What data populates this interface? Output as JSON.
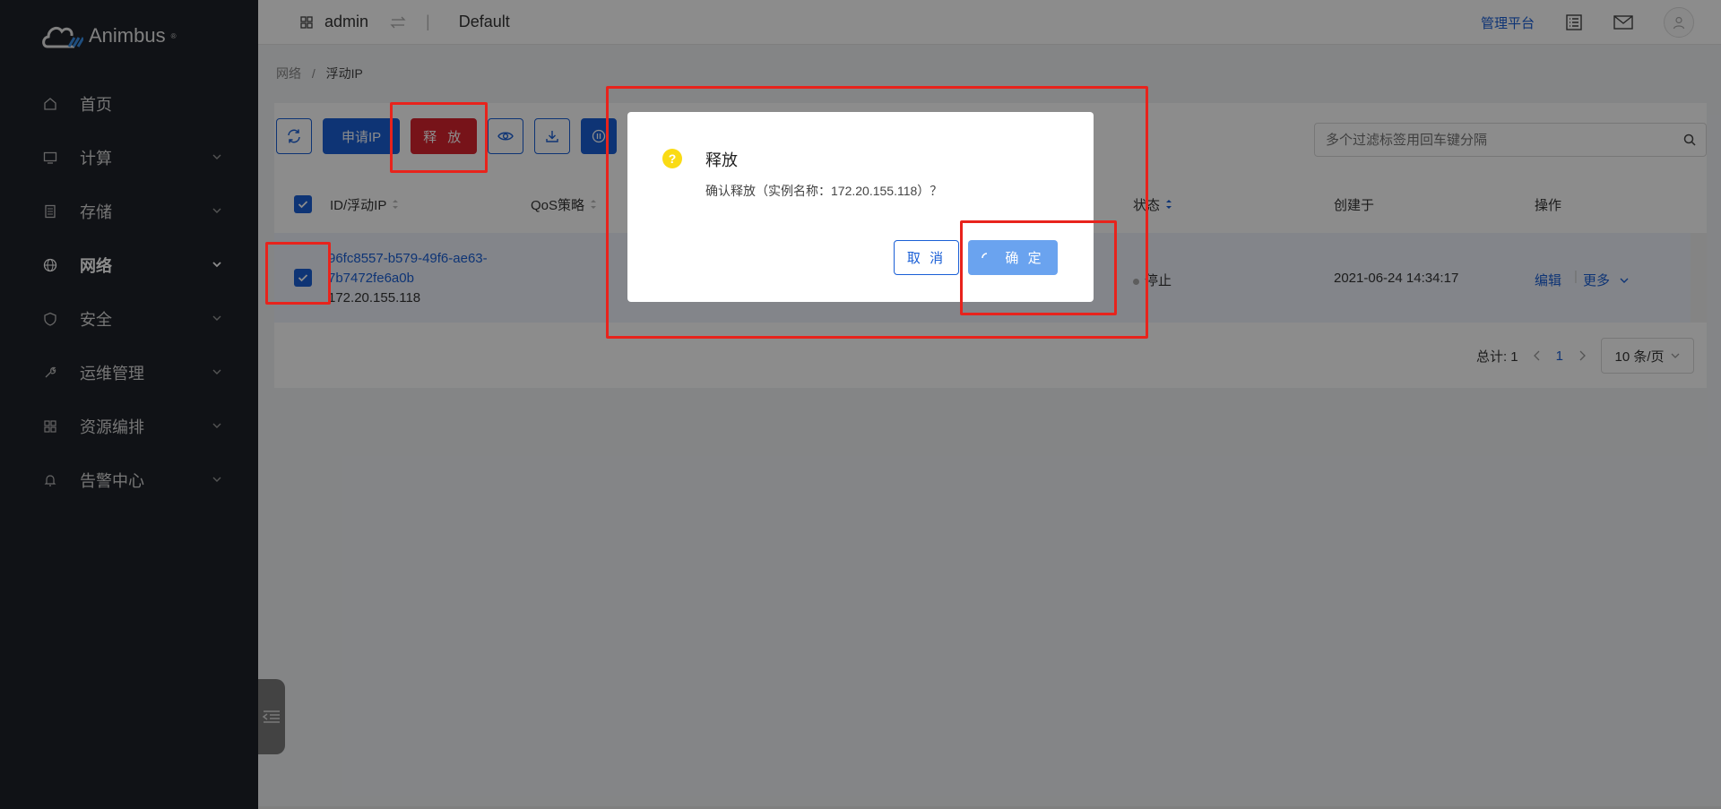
{
  "brand": {
    "name": "Animbus",
    "reg": "®"
  },
  "sidebar": {
    "items": [
      {
        "label": "首页",
        "icon": "home-icon",
        "expandable": false,
        "active": false
      },
      {
        "label": "计算",
        "icon": "monitor-icon",
        "expandable": true,
        "active": false
      },
      {
        "label": "存储",
        "icon": "storage-icon",
        "expandable": true,
        "active": false
      },
      {
        "label": "网络",
        "icon": "globe-icon",
        "expandable": true,
        "active": true
      },
      {
        "label": "安全",
        "icon": "shield-icon",
        "expandable": true,
        "active": false
      },
      {
        "label": "运维管理",
        "icon": "wrench-icon",
        "expandable": true,
        "active": false
      },
      {
        "label": "资源编排",
        "icon": "grid-icon",
        "expandable": true,
        "active": false
      },
      {
        "label": "告警中心",
        "icon": "bell-icon",
        "expandable": true,
        "active": false
      }
    ]
  },
  "header": {
    "user": "admin",
    "project": "Default",
    "admin_link": "管理平台"
  },
  "breadcrumb": {
    "parent": "网络",
    "separator": "/",
    "current": "浮动IP"
  },
  "toolbar": {
    "apply_ip": "申请IP",
    "release": "释 放",
    "search_placeholder": "多个过滤标签用回车键分隔"
  },
  "table": {
    "columns": {
      "id": "ID/浮动IP",
      "qos": "QoS策略",
      "status": "状态",
      "created": "创建于",
      "actions": "操作"
    },
    "rows": [
      {
        "id_line1": "96fc8557-b579-49f6-ae63-",
        "id_line2": "7b7472fe6a0b",
        "ip": "172.20.155.118",
        "status": "停止",
        "created": "2021-06-24 14:34:17",
        "edit": "编辑",
        "more": "更多"
      }
    ]
  },
  "pager": {
    "total_label": "总计: 1",
    "current_page": "1",
    "page_size": "10 条/页"
  },
  "dialog": {
    "title": "释放",
    "message": "确认释放（实例名称：172.20.155.118）？",
    "cancel": "取 消",
    "ok": "确 定"
  },
  "colors": {
    "primary": "#1a5fd6",
    "danger": "#d9232f",
    "sidebar": "#1e2128",
    "annotation": "#e8231c",
    "warning": "#fadb14"
  }
}
